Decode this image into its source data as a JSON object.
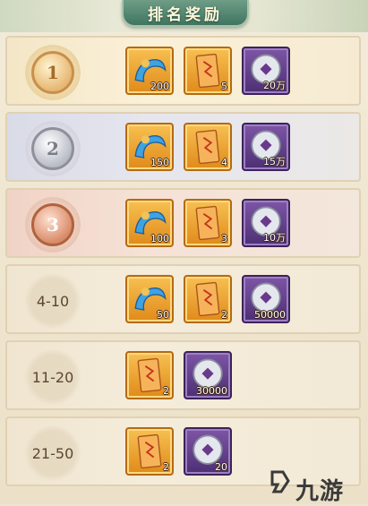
{
  "title": "排名奖励",
  "rows": [
    {
      "rank_badge": "1",
      "items": [
        {
          "icon": "blue-wave-token-icon",
          "qty": "200"
        },
        {
          "icon": "orange-scroll-icon",
          "qty": "5"
        },
        {
          "icon": "silver-coin-icon",
          "qty": "20万"
        }
      ]
    },
    {
      "rank_badge": "2",
      "items": [
        {
          "icon": "blue-wave-token-icon",
          "qty": "150"
        },
        {
          "icon": "orange-scroll-icon",
          "qty": "4"
        },
        {
          "icon": "silver-coin-icon",
          "qty": "15万"
        }
      ]
    },
    {
      "rank_badge": "3",
      "items": [
        {
          "icon": "blue-wave-token-icon",
          "qty": "100"
        },
        {
          "icon": "orange-scroll-icon",
          "qty": "3"
        },
        {
          "icon": "silver-coin-icon",
          "qty": "10万"
        }
      ]
    },
    {
      "range": "4-10",
      "items": [
        {
          "icon": "blue-wave-token-icon",
          "qty": "50"
        },
        {
          "icon": "orange-scroll-icon",
          "qty": "2"
        },
        {
          "icon": "silver-coin-icon",
          "qty": "50000"
        }
      ]
    },
    {
      "range": "11-20",
      "items": [
        {
          "icon": "orange-scroll-icon",
          "qty": "2"
        },
        {
          "icon": "silver-coin-icon",
          "qty": "30000"
        }
      ]
    },
    {
      "range": "21-50",
      "items": [
        {
          "icon": "orange-scroll-icon",
          "qty": "2"
        },
        {
          "icon": "silver-coin-icon",
          "qty": "20"
        }
      ]
    }
  ],
  "watermark": "九游",
  "colors": {
    "gold_frame": "#e08a1a",
    "purple_frame": "#4d2f73",
    "banner": "#3f7561"
  }
}
